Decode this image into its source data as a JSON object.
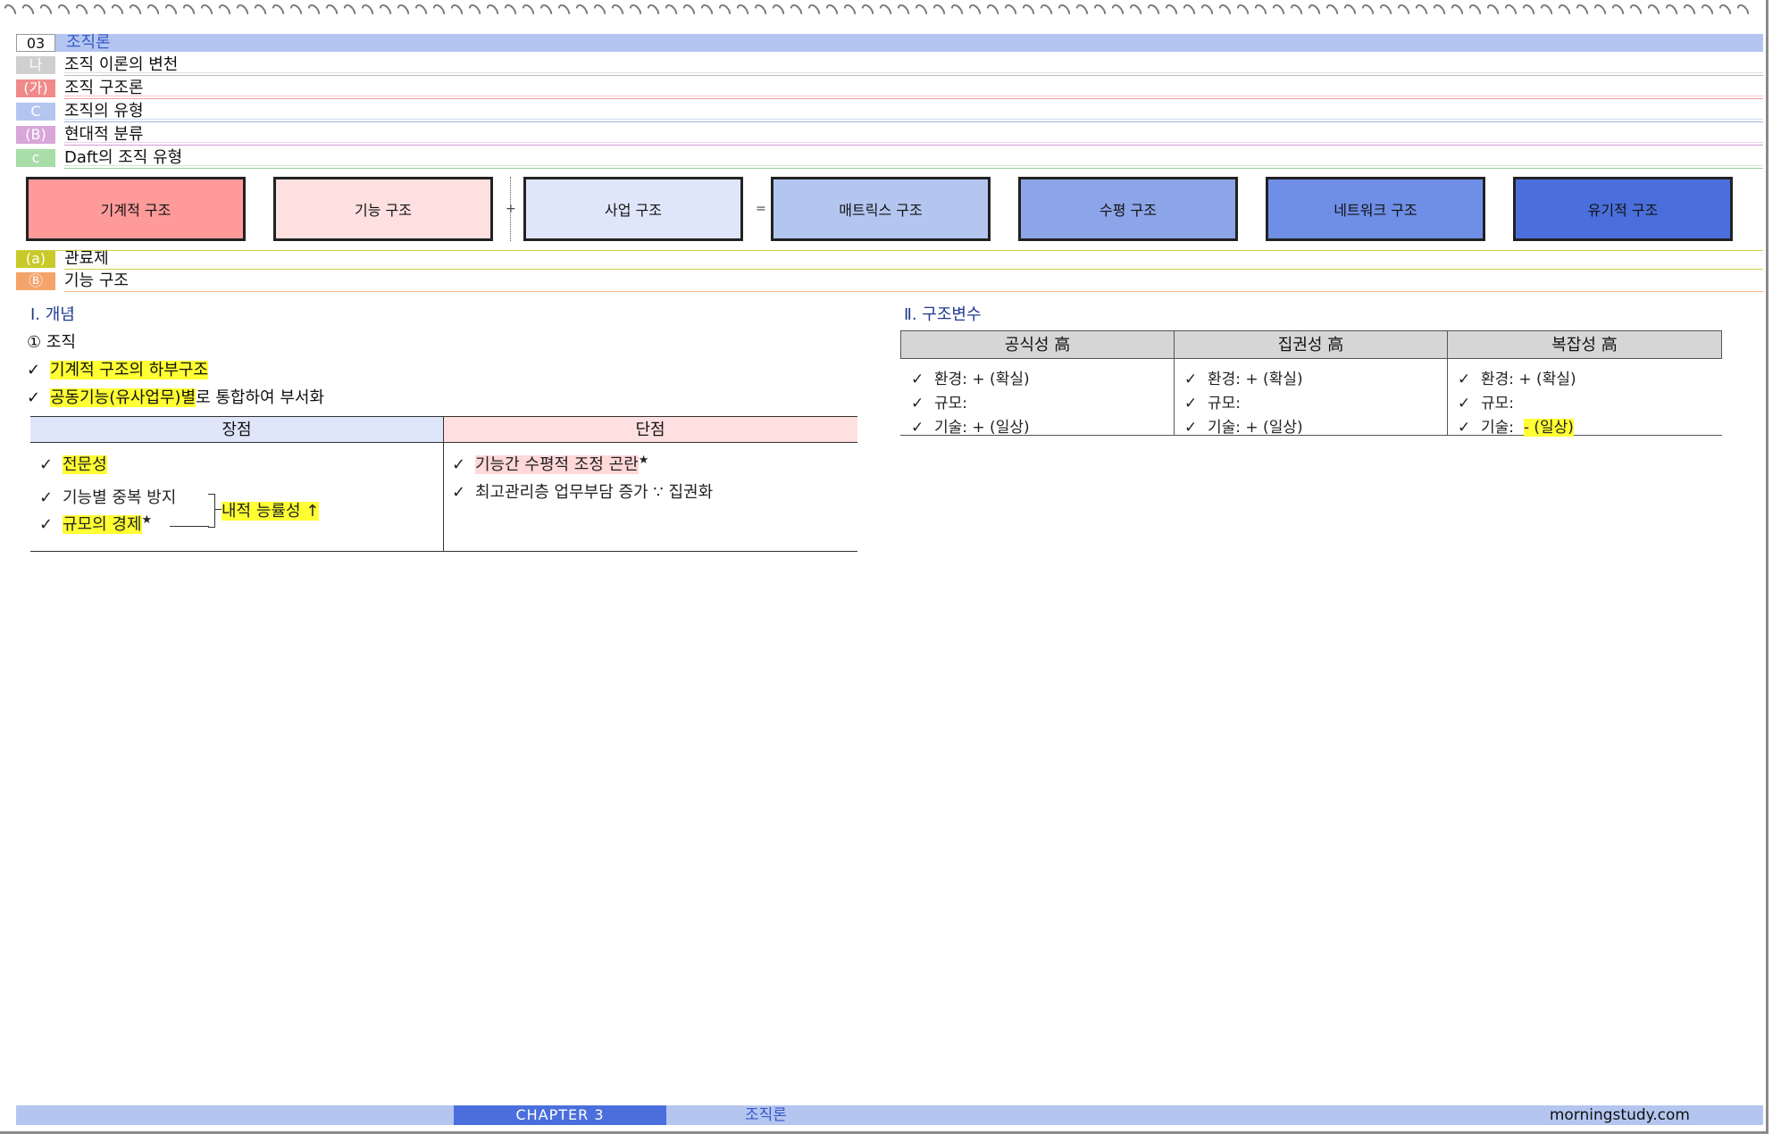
{
  "header_rows": [
    {
      "tag": "03",
      "title": "조직론"
    },
    {
      "tag": "나",
      "title": "조직 이론의 변천"
    },
    {
      "tag": "(가)",
      "title": "조직 구조론"
    },
    {
      "tag": "C",
      "title": "조직의 유형"
    },
    {
      "tag": "(B)",
      "title": "현대적 분류"
    },
    {
      "tag": "c",
      "title": "Daft의 조직 유형"
    }
  ],
  "daft": {
    "boxes": [
      "기계적 구조",
      "기능 구조",
      "사업 구조",
      "매트릭스 구조",
      "수평 구조",
      "네트워크 구조",
      "유기적 구조"
    ],
    "plus": "+",
    "equals": "="
  },
  "sub_rows": [
    {
      "tag": "(a)",
      "title": "관료제"
    },
    {
      "tag": "Ⓑ",
      "title": "기능 구조"
    }
  ],
  "concept": {
    "title": "Ⅰ. 개념",
    "item_marker": "①",
    "item_label": "조직",
    "bullet1": "기계적 구조의 하부구조",
    "bullet2_hl": "공동기능(유사업무)별",
    "bullet2_rest": "로 통합하여 부서화"
  },
  "pros_cons": {
    "pros_header": "장점",
    "cons_header": "단점",
    "pro1": "전문성",
    "pro2": "기능별 중복 방지",
    "pro3": "규모의 경제",
    "star": "★",
    "pro_result": "내적 능률성 ↑",
    "con1": "기능간 수평적 조정 곤란",
    "con2": "최고관리층 업무부담 증가 ∵ 집권화"
  },
  "variables": {
    "title": "Ⅱ. 구조변수",
    "headers": [
      "공식성 高",
      "집권성 高",
      "복잡성 高"
    ],
    "columns": [
      [
        "환경: + (확실)",
        "규모:",
        "기술: + (일상)"
      ],
      [
        "환경: + (확실)",
        "규모:",
        "기술: + (일상)"
      ],
      [
        "환경:  + (확실)",
        "규모:",
        "기술:"
      ]
    ],
    "col3_tech_hl": "- (일상)"
  },
  "check": "✓",
  "footer": {
    "chapter": "CHAPTER 3",
    "chapter_title": "조직론",
    "site": "morningstudy.com"
  },
  "colors": {
    "row0": "#b4c6f0",
    "row1": "#cfcfcf",
    "row2": "#f08a8a",
    "row3": "#b4c6f0",
    "row4": "#d8a6d8",
    "row5": "#a8dca8",
    "sub0": "#c9c92a",
    "sub1": "#f4a36a",
    "box": [
      "#ff9a9a",
      "#ffe0e0",
      "#dfe6fa",
      "#b4c6f0",
      "#8ca4e8",
      "#6f8fe6",
      "#4a6fdc"
    ],
    "highlight": "#ffff33",
    "footer_bar": "#b4c6f0",
    "chapter_bg": "#4a6fdc"
  }
}
